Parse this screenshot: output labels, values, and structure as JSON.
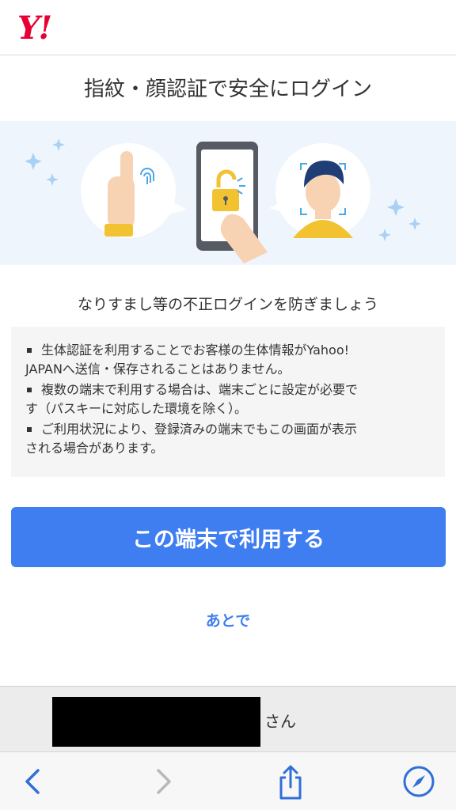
{
  "header": {
    "logo_text": "Y!",
    "brand_color": "#e60033"
  },
  "page": {
    "title": "指紋・顔認証で安全にログイン",
    "subtitle": "なりすまし等の不正ログインを防ぎましょう"
  },
  "notes": [
    {
      "line1": "生体認証を利用することでお客様の生体情報がYahoo!",
      "line2": "JAPANへ送信・保存されることはありません。"
    },
    {
      "line1": "複数の端末で利用する場合は、端末ごとに設定が必要で",
      "line2": "す（パスキーに対応した環境を除く）。"
    },
    {
      "line1": "ご利用状況により、登録済みの端末でもこの画面が表示",
      "line2": "される場合があります。"
    }
  ],
  "actions": {
    "primary_label": "この端末で利用する",
    "later_label": "あとで",
    "accent_color": "#3f7ef0"
  },
  "user_bar": {
    "suffix": "さん"
  },
  "toolbar": {
    "icons": [
      "chevron-left-icon",
      "chevron-right-icon",
      "share-icon",
      "compass-icon"
    ]
  }
}
